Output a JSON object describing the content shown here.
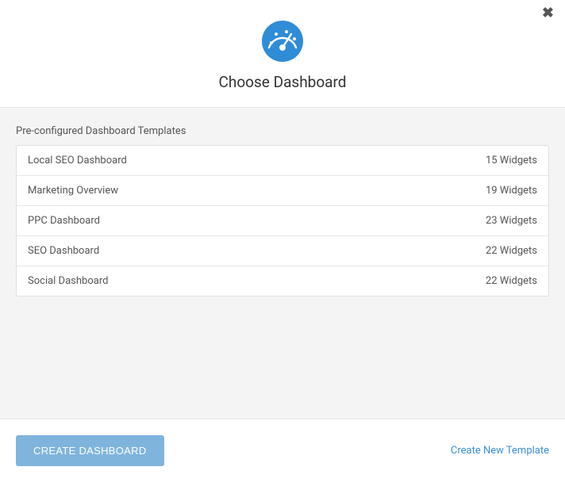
{
  "header": {
    "title": "Choose Dashboard",
    "icon": "gauge-icon"
  },
  "section_label": "Pre-configured Dashboard Templates",
  "templates": [
    {
      "name": "Local SEO Dashboard",
      "count": "15 Widgets"
    },
    {
      "name": "Marketing Overview",
      "count": "19 Widgets"
    },
    {
      "name": "PPC Dashboard",
      "count": "23 Widgets"
    },
    {
      "name": "SEO Dashboard",
      "count": "22 Widgets"
    },
    {
      "name": "Social Dashboard",
      "count": "22 Widgets"
    }
  ],
  "footer": {
    "create_button": "CREATE DASHBOARD",
    "create_link": "Create New Template"
  }
}
